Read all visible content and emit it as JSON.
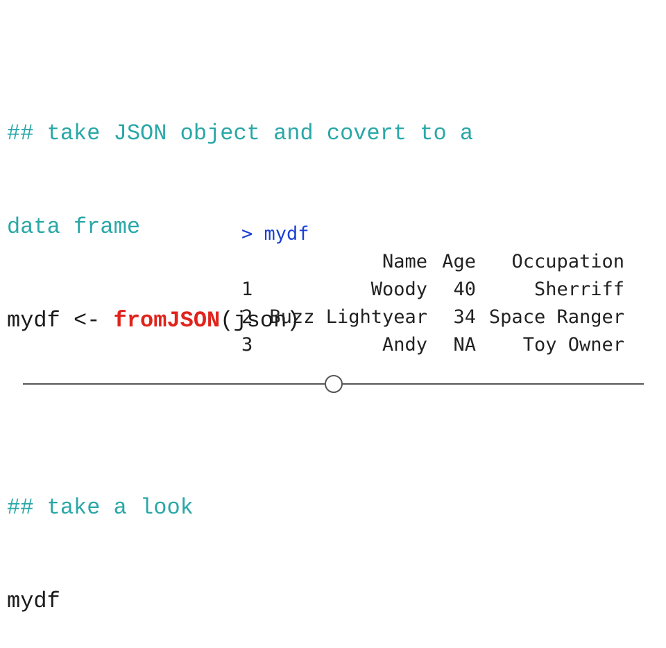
{
  "code": {
    "comment1_line1": "## take JSON object and covert to a",
    "comment1_line2": "data frame",
    "assign_prefix": "mydf <- ",
    "function_name": "fromJSON",
    "function_args": "(json)",
    "comment2": "## take a look",
    "print_stmt": "mydf"
  },
  "console": {
    "prompt": "> mydf",
    "columns": [
      "Name",
      "Age",
      "Occupation"
    ],
    "rows": [
      {
        "index": "1",
        "name": "Woody",
        "age": "40",
        "occupation": "Sherriff"
      },
      {
        "index": "2",
        "name": "Buzz Lightyear",
        "age": "34",
        "occupation": "Space Ranger"
      },
      {
        "index": "3",
        "name": "Andy",
        "age": "NA",
        "occupation": "Toy Owner"
      }
    ]
  },
  "colors": {
    "comment": "#2aa7a7",
    "function": "#e0231b",
    "prompt": "#1a3fd8",
    "text": "#1a1a1a"
  }
}
